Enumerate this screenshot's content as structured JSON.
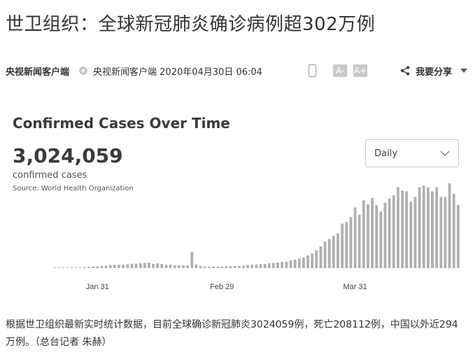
{
  "headline": "世卫组织：全球新冠肺炎确诊病例超302万例",
  "meta": {
    "source": "央视新闻客户端",
    "source_time": "央视新闻客户端 2020年04月30日 06:04",
    "font_decrease": "A-",
    "font_increase": "A+",
    "share_label": "我要分享"
  },
  "chart_widget": {
    "title": "Confirmed Cases Over Time",
    "total": "3,024,059",
    "total_label": "confirmed cases",
    "source": "Source: World Health Organization",
    "dropdown_value": "Daily"
  },
  "chart_data": {
    "type": "bar",
    "title": "Confirmed Cases Over Time",
    "xlabel": "",
    "ylabel": "",
    "x_tick_labels": [
      "Jan 31",
      "Feb 29",
      "Mar 31"
    ],
    "x_tick_day_index": [
      10,
      39,
      70
    ],
    "bar_color": "#b0b0b0",
    "grid": false,
    "ylim": [
      0,
      110000
    ],
    "values": [
      50,
      100,
      150,
      200,
      300,
      600,
      900,
      1200,
      1500,
      2000,
      2100,
      2600,
      3000,
      3800,
      4000,
      4100,
      4200,
      4800,
      5300,
      5500,
      6000,
      6500,
      6800,
      5200,
      5800,
      5200,
      4200,
      4300,
      3500,
      3500,
      3500,
      3600,
      20000,
      4500,
      2800,
      2000,
      2000,
      2000,
      1800,
      1900,
      2200,
      2300,
      2500,
      2600,
      2800,
      4000,
      4500,
      4600,
      5000,
      5100,
      5900,
      6500,
      7000,
      7800,
      8000,
      9400,
      10300,
      11800,
      13000,
      15600,
      18000,
      22000,
      27000,
      33000,
      36000,
      40000,
      43000,
      55000,
      57000,
      63000,
      75000,
      66000,
      84000,
      79000,
      87000,
      78000,
      70000,
      81000,
      86000,
      90000,
      100000,
      96000,
      95000,
      82000,
      88000,
      100000,
      102000,
      100000,
      95000,
      100000,
      88000,
      88000,
      105000,
      92000,
      78000
    ]
  },
  "body_text": "根据世卫组织最新实时统计数据，目前全球确诊新冠肺炎3024059例，死亡208112例，中国以外近294万例。（总台记者 朱赫）"
}
